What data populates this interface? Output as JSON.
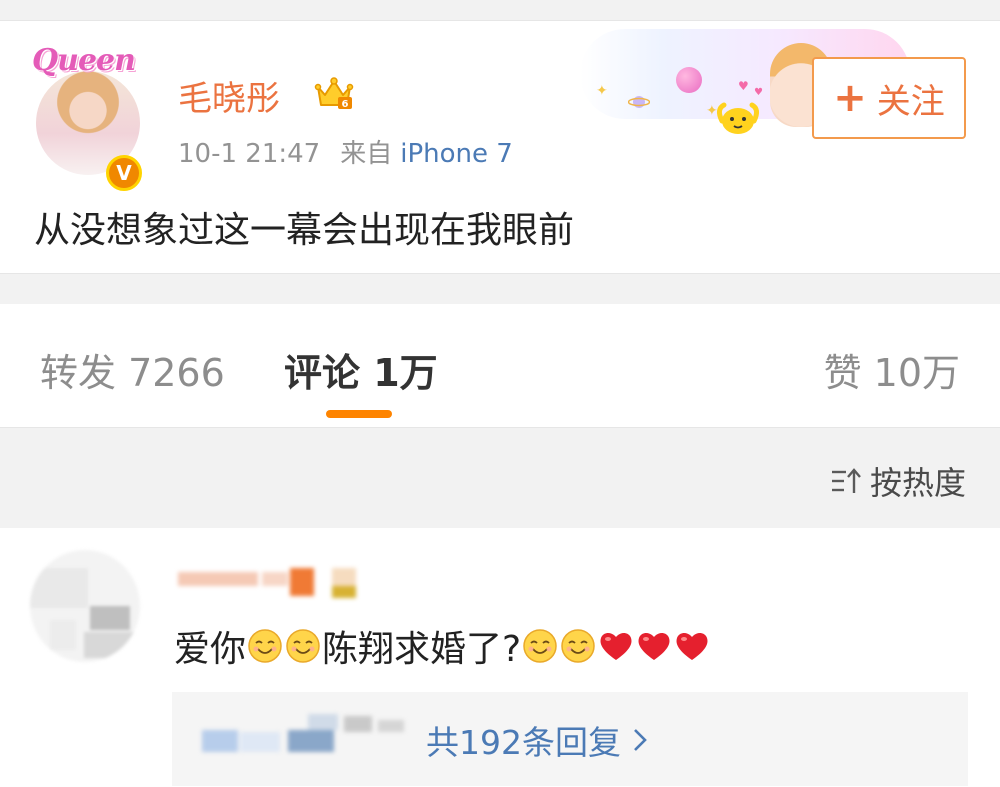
{
  "post": {
    "avatar_logo_text": "Queen",
    "verify_badge": "V",
    "username": "毛晓彤",
    "time": "10-1 21:47",
    "from_label": "来自",
    "device": "iPhone 7",
    "follow_plus": "+",
    "follow_label": "关注",
    "text": "从没想象过这一幕会出现在我眼前",
    "icons": [
      "crown-badge-icon",
      "planet-icon",
      "mascot-icon"
    ]
  },
  "tabs": {
    "repost": "转发 7266",
    "comment": "评论 1万",
    "like": "赞 10万",
    "active_color": "#fe8400"
  },
  "sort": {
    "label": "按热度",
    "icon": "sort-icon"
  },
  "comment": {
    "text_part1": "爱你",
    "text_part2": "陈翔求婚了?",
    "emoji_smile": "smile-emoji",
    "emoji_heart": "heart-emoji",
    "reply_count": "共192条回复",
    "reply_chevron": "chevron-right-icon"
  },
  "colors": {
    "username": "#eb7340",
    "link": "#4b7ab5",
    "accent": "#fe8400",
    "verify": "#f08800"
  }
}
